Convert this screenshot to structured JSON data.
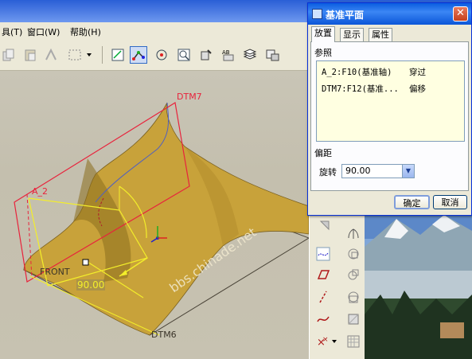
{
  "menu": {
    "item_tools_partial": "具(T)",
    "item_window": "窗口(W)",
    "item_help": "帮助(H)"
  },
  "viewport": {
    "labels": {
      "dtm7": "DTM7",
      "a2": "A_2",
      "front": "FRONT",
      "dtm6": "DTM6",
      "dimension": "90.00"
    },
    "watermark": "bbs.chinade.net",
    "colors": {
      "surface": "#c8a23a",
      "plane_red": "#e8233c",
      "axis_yellow": "#f3ee2a"
    }
  },
  "dialog": {
    "title": "基准平面",
    "close_glyph": "✕",
    "tabs": [
      {
        "label": "放置"
      },
      {
        "label": "显示"
      },
      {
        "label": "属性"
      }
    ],
    "references_label": "参照",
    "references": [
      {
        "ref": "A_2:F10(基准轴)",
        "type": "穿过"
      },
      {
        "ref": "DTM7:F12(基准...",
        "type": "偏移"
      }
    ],
    "offset_label": "偏距",
    "rotate_label": "旋转",
    "rotate_value": "90.00",
    "ok_label": "确定",
    "cancel_label": "取消"
  }
}
